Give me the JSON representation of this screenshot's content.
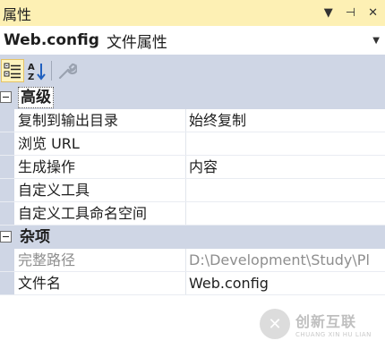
{
  "window": {
    "title": "属性",
    "icons": [
      "dropdown-arrow-icon",
      "pin-icon",
      "close-icon"
    ],
    "icon_glyphs": [
      "▼",
      "⊣",
      "✕"
    ]
  },
  "object_selector": {
    "name": "Web.config",
    "type": "文件属性"
  },
  "toolbar": {
    "buttons": [
      {
        "name": "categorized-view-icon",
        "active": true
      },
      {
        "name": "alphabetical-sort-icon",
        "active": false
      },
      {
        "name": "property-pages-wrench-icon",
        "active": false
      }
    ]
  },
  "grid": {
    "categories": [
      {
        "label": "高级",
        "expanded": true,
        "selected": true,
        "rows": [
          {
            "name": "复制到输出目录",
            "value": "始终复制",
            "readonly": false
          },
          {
            "name": "浏览 URL",
            "value": "",
            "readonly": false
          },
          {
            "name": "生成操作",
            "value": "内容",
            "readonly": false
          },
          {
            "name": "自定义工具",
            "value": "",
            "readonly": false
          },
          {
            "name": "自定义工具命名空间",
            "value": "",
            "readonly": false
          }
        ]
      },
      {
        "label": "杂项",
        "expanded": true,
        "selected": false,
        "rows": [
          {
            "name": "完整路径",
            "value": "D:\\Development\\Study\\Pl",
            "readonly": true
          },
          {
            "name": "文件名",
            "value": "Web.config",
            "readonly": false
          }
        ]
      }
    ]
  },
  "watermark": {
    "logo_text": "✕",
    "text_cn": "创新互联",
    "text_en": "CHUANG XIN HU LIAN"
  },
  "colors": {
    "title_bg": "#fdf0b4",
    "category_bg": "#cfd6e5",
    "readonly_text": "#8e8e8e"
  }
}
